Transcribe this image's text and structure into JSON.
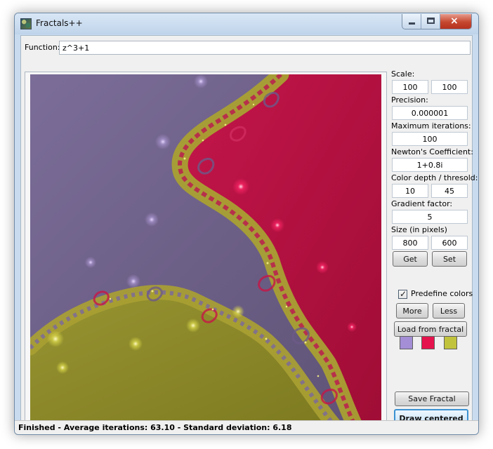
{
  "window": {
    "title": "Fractals++",
    "controls": {
      "minimize": "minimize-icon",
      "maximize": "maximize-icon",
      "close": "close-icon"
    }
  },
  "function_field": {
    "label": "Function:",
    "value": "z^3+1"
  },
  "sidebar": {
    "scale_label": "Scale:",
    "scale_x": "100",
    "scale_y": "100",
    "precision_label": "Precision:",
    "precision_value": "0.000001",
    "max_iterations_label": "Maximum iterations:",
    "max_iterations_value": "100",
    "newton_label": "Newton's Coefficient:",
    "newton_value": "1+0.8i",
    "color_depth_label": "Color depth / thresold:",
    "color_depth_value": "10",
    "threshold_value": "45",
    "gradient_label": "Gradient factor:",
    "gradient_value": "5",
    "size_label": "Size (in pixels)",
    "size_width": "800",
    "size_height": "600",
    "get_label": "Get",
    "set_label": "Set",
    "predefine_colors_label": "Predefine colors",
    "predefine_colors_checked": true,
    "more_label": "More",
    "less_label": "Less",
    "load_label": "Load from fractal",
    "swatches": [
      "#a48ed6",
      "#e5134d",
      "#c2c33d"
    ]
  },
  "actions": {
    "save_label": "Save Fractal",
    "draw_label": "Draw centered"
  },
  "status": {
    "text": "Finished - Average iterations: 63.10 - Standard deviation: 6.18"
  },
  "fractal_colors": {
    "purple": "#6b5c84",
    "crimson": "#b60f3e",
    "olive": "#8c8927",
    "highlight_purple": "#b39ddc",
    "highlight_red": "#ff2668",
    "highlight_yellow": "#e0dd4c"
  }
}
